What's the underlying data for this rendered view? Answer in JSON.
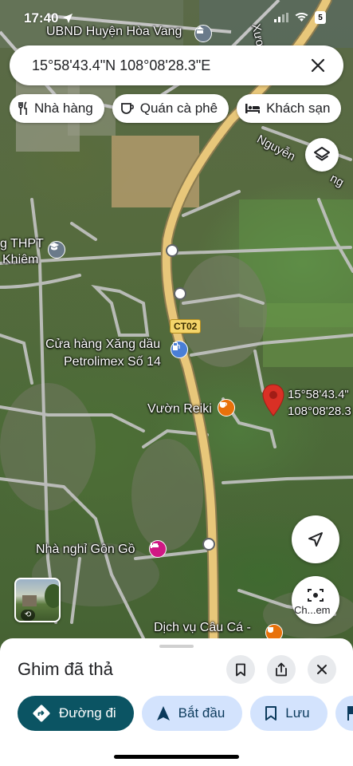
{
  "status_bar": {
    "time": "17:40",
    "battery": "5",
    "icons": [
      "location-arrow-icon",
      "signal-icon",
      "wifi-icon",
      "battery-icon"
    ]
  },
  "search": {
    "value": "15°58'43.4\"N 108°08'28.3\"E"
  },
  "chips": [
    {
      "label": "Nhà hàng",
      "icon": "restaurant-icon"
    },
    {
      "label": "Quán cà phê",
      "icon": "coffee-icon"
    },
    {
      "label": "Khách sạn",
      "icon": "hotel-icon"
    }
  ],
  "map": {
    "labels": {
      "ubnd": "UBND Huyện Hòa Vang",
      "xuong": "Xương",
      "nguyen": "Nguyễn",
      "dong": "ng",
      "thpt_1": "g THPT",
      "thpt_2": "Khiêm",
      "ct02": "CT02",
      "gas_1": "Cửa hàng Xăng dầu",
      "gas_2": "Petrolimex Số 14",
      "reiki": "Vườn Reiki",
      "pin_1": "15°58'43.4\"",
      "pin_2": "108°08'28.3",
      "nha_nghi": "Nhà nghỉ Gôn Gồ",
      "dich_vu": "Dịch vụ Câu Cá -",
      "camera_label": "Ch...em"
    },
    "colors": {
      "road_main": "#e8c77a",
      "road_minor": "#b8b8b8",
      "pin": "#d93025",
      "gas": "#4a7fd6",
      "cafe": "#e8710a",
      "hotel": "#d01884",
      "school": "#6a7a8a"
    }
  },
  "sheet": {
    "title": "Ghim đã thả",
    "actions": [
      {
        "label": "Đường đi",
        "icon": "directions-icon"
      },
      {
        "label": "Bắt đầu",
        "icon": "navigation-icon"
      },
      {
        "label": "Lưu",
        "icon": "bookmark-icon"
      }
    ]
  }
}
